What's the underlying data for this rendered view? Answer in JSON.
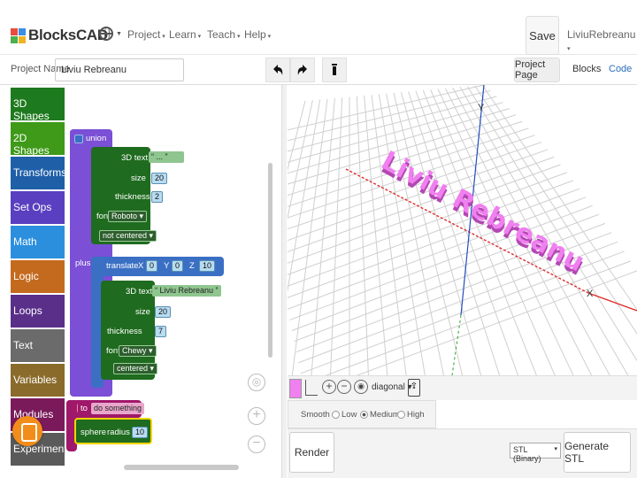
{
  "colors": {
    "accent_pink": "#f07ff0",
    "axis_red": "#e22b2b",
    "axis_green": "#2ca02c",
    "axis_blue": "#1f4fbf",
    "block_union": "#7b4fd6",
    "block_transform": "#3a6fc4",
    "block_3d": "#1f6b1f",
    "block_module": "#a0186a"
  },
  "header": {
    "logo_text": "BlocksCAD",
    "menu": [
      "Project",
      "Learn",
      "Teach",
      "Help"
    ],
    "save_label": "Save",
    "user_name": "LiviuRebreanu"
  },
  "project_bar": {
    "label": "Project Name",
    "value": "Liviu Rebreanu",
    "undo_icon": "undo-icon",
    "redo_icon": "redo-icon",
    "delete_icon": "trash-icon",
    "tabs": [
      "Project Page",
      "Blocks",
      "Code"
    ]
  },
  "toolbox": {
    "categories": [
      {
        "label": "3D Shapes",
        "color": "#1e7a1e"
      },
      {
        "label": "2D Shapes",
        "color": "#3e9a18"
      },
      {
        "label": "Transforms",
        "color": "#1f5fa8"
      },
      {
        "label": "Set Ops",
        "color": "#5a3fc0"
      },
      {
        "label": "Math",
        "color": "#2b8fde"
      },
      {
        "label": "Logic",
        "color": "#c46a1f"
      },
      {
        "label": "Loops",
        "color": "#5a2f8a"
      },
      {
        "label": "Text",
        "color": "#6b6b6b"
      },
      {
        "label": "Variables",
        "color": "#8a6b2b"
      },
      {
        "label": "Modules",
        "color": "#7a1a5a"
      },
      {
        "label": "Experimental",
        "color": "#5a5a5a"
      }
    ]
  },
  "blocks": {
    "union_label": "union",
    "text_block_1": {
      "label": "3D text",
      "text": "...",
      "size_label": "size",
      "size": "20",
      "thickness_label": "thickness",
      "thickness": "2",
      "font_label": "font",
      "font": "Roboto",
      "align": "not centered"
    },
    "plus_label": "plus",
    "translate": {
      "label": "translate",
      "x_label": "X",
      "x": "0",
      "y_label": "Y",
      "y": "0",
      "z_label": "Z",
      "z": "10"
    },
    "text_block_2": {
      "label": "3D text",
      "text": "Liviu Rebreanu",
      "size_label": "size",
      "size": "20",
      "thickness_label": "thickness",
      "thickness": "7",
      "font_label": "font",
      "font": "Chewy",
      "align": "centered"
    },
    "module": {
      "to_label": "to",
      "name": "do something",
      "sphere_label": "sphere",
      "radius_label": "radius",
      "radius": "10"
    }
  },
  "viewport": {
    "render_text": "Liviu Rebreanu",
    "x_axis_label": "X",
    "y_axis_label": "Y",
    "view_mode": "diagonal",
    "smooth_label": "Smooth",
    "smooth_options": [
      "Low",
      "Medium",
      "High"
    ],
    "smooth_selected": "Medium",
    "render_label": "Render",
    "export_format": "STL (Binary)",
    "generate_label": "Generate STL"
  }
}
